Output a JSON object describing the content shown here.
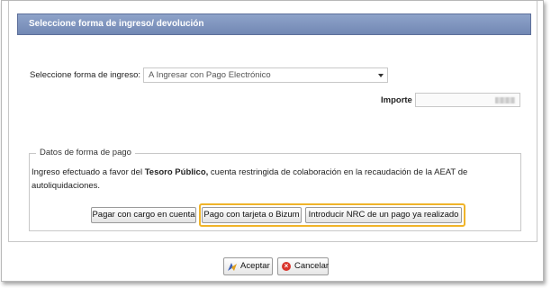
{
  "header": {
    "title": "Seleccione forma de ingreso/ devolución"
  },
  "form": {
    "ingreso_label": "Seleccione forma de ingreso:",
    "ingreso_selected": "A Ingresar con Pago Electrónico",
    "importe_label": "Importe"
  },
  "payment": {
    "legend": "Datos de forma de pago",
    "desc_prefix": "Ingreso efectuado a favor del",
    "desc_bold": "Tesoro Público,",
    "desc_suffix": " cuenta restringida de colaboración en la recaudación de la AEAT de autoliquidaciones."
  },
  "buttons": {
    "cargo_cuenta": "Pagar con cargo en cuenta",
    "tarjeta_bizum": "Pago con tarjeta o Bizum",
    "introducir_nrc": "Introducir NRC de un pago ya realizado"
  },
  "footer": {
    "accept": "Aceptar",
    "cancel": "Cancelar"
  },
  "colors": {
    "header_bg": "#7f95bf",
    "highlight": "#f0b429",
    "cancel_icon": "#d9342b"
  },
  "icons": {
    "accept": "accept-icon",
    "cancel": "cancel-icon",
    "dropdown": "chevron-down-icon"
  }
}
